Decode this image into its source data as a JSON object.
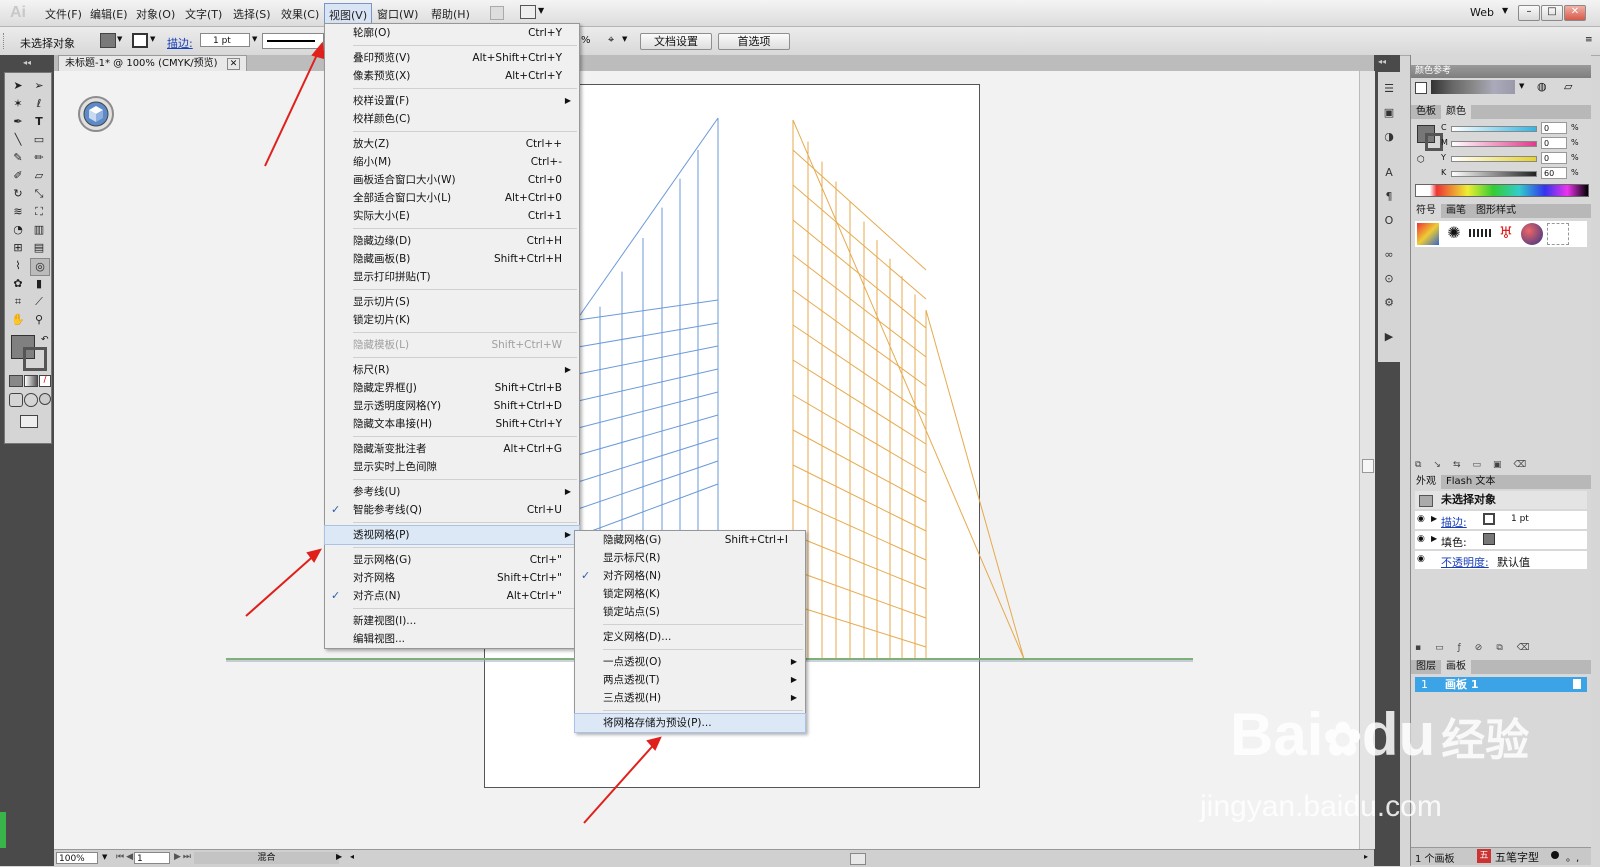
{
  "app": {
    "logo": "Ai",
    "workspace": "Web"
  },
  "menubar": {
    "items": [
      "文件(F)",
      "编辑(E)",
      "对象(O)",
      "文字(T)",
      "选择(S)",
      "效果(C)",
      "视图(V)",
      "窗口(W)",
      "帮助(H)"
    ],
    "active_index": 6
  },
  "control_bar": {
    "selection": "未选择对象",
    "stroke_label": "描边:",
    "stroke_value": "1 pt",
    "doc_setup": "文档设置",
    "preferences": "首选项",
    "percent": "%"
  },
  "document_tab": {
    "title": "未标题-1* @ 100% (CMYK/预览)"
  },
  "view_menu": {
    "items": [
      {
        "label": "轮廓(O)",
        "shortcut": "Ctrl+Y"
      },
      {
        "sep": true
      },
      {
        "label": "叠印预览(V)",
        "shortcut": "Alt+Shift+Ctrl+Y"
      },
      {
        "label": "像素预览(X)",
        "shortcut": "Alt+Ctrl+Y"
      },
      {
        "sep": true
      },
      {
        "label": "校样设置(F)",
        "submenu": true
      },
      {
        "label": "校样颜色(C)"
      },
      {
        "sep": true
      },
      {
        "label": "放大(Z)",
        "shortcut": "Ctrl++"
      },
      {
        "label": "缩小(M)",
        "shortcut": "Ctrl+-"
      },
      {
        "label": "画板适合窗口大小(W)",
        "shortcut": "Ctrl+0"
      },
      {
        "label": "全部适合窗口大小(L)",
        "shortcut": "Alt+Ctrl+0"
      },
      {
        "label": "实际大小(E)",
        "shortcut": "Ctrl+1"
      },
      {
        "sep": true
      },
      {
        "label": "隐藏边缘(D)",
        "shortcut": "Ctrl+H"
      },
      {
        "label": "隐藏画板(B)",
        "shortcut": "Shift+Ctrl+H"
      },
      {
        "label": "显示打印拼贴(T)"
      },
      {
        "sep": true
      },
      {
        "label": "显示切片(S)"
      },
      {
        "label": "锁定切片(K)"
      },
      {
        "sep": true
      },
      {
        "label": "隐藏模板(L)",
        "shortcut": "Shift+Ctrl+W",
        "disabled": true
      },
      {
        "sep": true
      },
      {
        "label": "标尺(R)",
        "submenu": true
      },
      {
        "label": "隐藏定界框(J)",
        "shortcut": "Shift+Ctrl+B"
      },
      {
        "label": "显示透明度网格(Y)",
        "shortcut": "Shift+Ctrl+D"
      },
      {
        "label": "隐藏文本串接(H)",
        "shortcut": "Shift+Ctrl+Y"
      },
      {
        "sep": true
      },
      {
        "label": "隐藏渐变批注者",
        "shortcut": "Alt+Ctrl+G"
      },
      {
        "label": "显示实时上色间隙"
      },
      {
        "sep": true
      },
      {
        "label": "参考线(U)",
        "submenu": true
      },
      {
        "label": "智能参考线(Q)",
        "shortcut": "Ctrl+U",
        "checked": true
      },
      {
        "sep": true
      },
      {
        "label": "透视网格(P)",
        "submenu": true,
        "highlighted": true
      },
      {
        "sep": true
      },
      {
        "label": "显示网格(G)",
        "shortcut": "Ctrl+\""
      },
      {
        "label": "对齐网格",
        "shortcut": "Shift+Ctrl+\""
      },
      {
        "label": "对齐点(N)",
        "shortcut": "Alt+Ctrl+\"",
        "checked": true
      },
      {
        "sep": true
      },
      {
        "label": "新建视图(I)..."
      },
      {
        "label": "编辑视图..."
      }
    ]
  },
  "perspective_submenu": {
    "items": [
      {
        "label": "隐藏网格(G)",
        "shortcut": "Shift+Ctrl+I"
      },
      {
        "label": "显示标尺(R)"
      },
      {
        "label": "对齐网格(N)",
        "checked": true
      },
      {
        "label": "锁定网格(K)"
      },
      {
        "label": "锁定站点(S)"
      },
      {
        "sep": true
      },
      {
        "label": "定义网格(D)..."
      },
      {
        "sep": true
      },
      {
        "label": "一点透视(O)",
        "submenu": true
      },
      {
        "label": "两点透视(T)",
        "submenu": true
      },
      {
        "label": "三点透视(H)",
        "submenu": true
      },
      {
        "sep": true
      },
      {
        "label": "将网格存储为预设(P)...",
        "highlighted": true
      }
    ]
  },
  "panels": {
    "color_guide_title": "颜色参考",
    "color_tabs": [
      "色板",
      "颜色"
    ],
    "cmyk": [
      {
        "ch": "C",
        "val": "0"
      },
      {
        "ch": "M",
        "val": "0"
      },
      {
        "ch": "Y",
        "val": "0"
      },
      {
        "ch": "K",
        "val": "60"
      }
    ],
    "pct": "%",
    "symbol_tabs": [
      "符号",
      "画笔",
      "图形样式"
    ],
    "appearance_tabs": [
      "外观",
      "Flash 文本"
    ],
    "appearance": {
      "title": "未选择对象",
      "stroke_label": "描边:",
      "stroke_value": "1 pt",
      "fill_label": "填色:",
      "opacity_label": "不透明度:",
      "opacity_value": "默认值"
    },
    "layer_tabs": [
      "图层",
      "画板"
    ],
    "artboard_item": {
      "num": "1",
      "name": "画板 1"
    },
    "artboard_count": "1 个画板",
    "ime": "五笔字型"
  },
  "status_bar": {
    "zoom": "100%",
    "page": "1",
    "mode": "混合"
  },
  "watermark": {
    "brand": "Bai",
    "brand2": "du",
    "cn": "经验",
    "url": "jingyan.baidu.com"
  },
  "colors": {
    "grid_left": "#5b8fd6",
    "grid_right": "#e4a13c",
    "horizon": "#7fb07a",
    "arrow": "#e0201b",
    "accent": "#2b5ea8"
  }
}
